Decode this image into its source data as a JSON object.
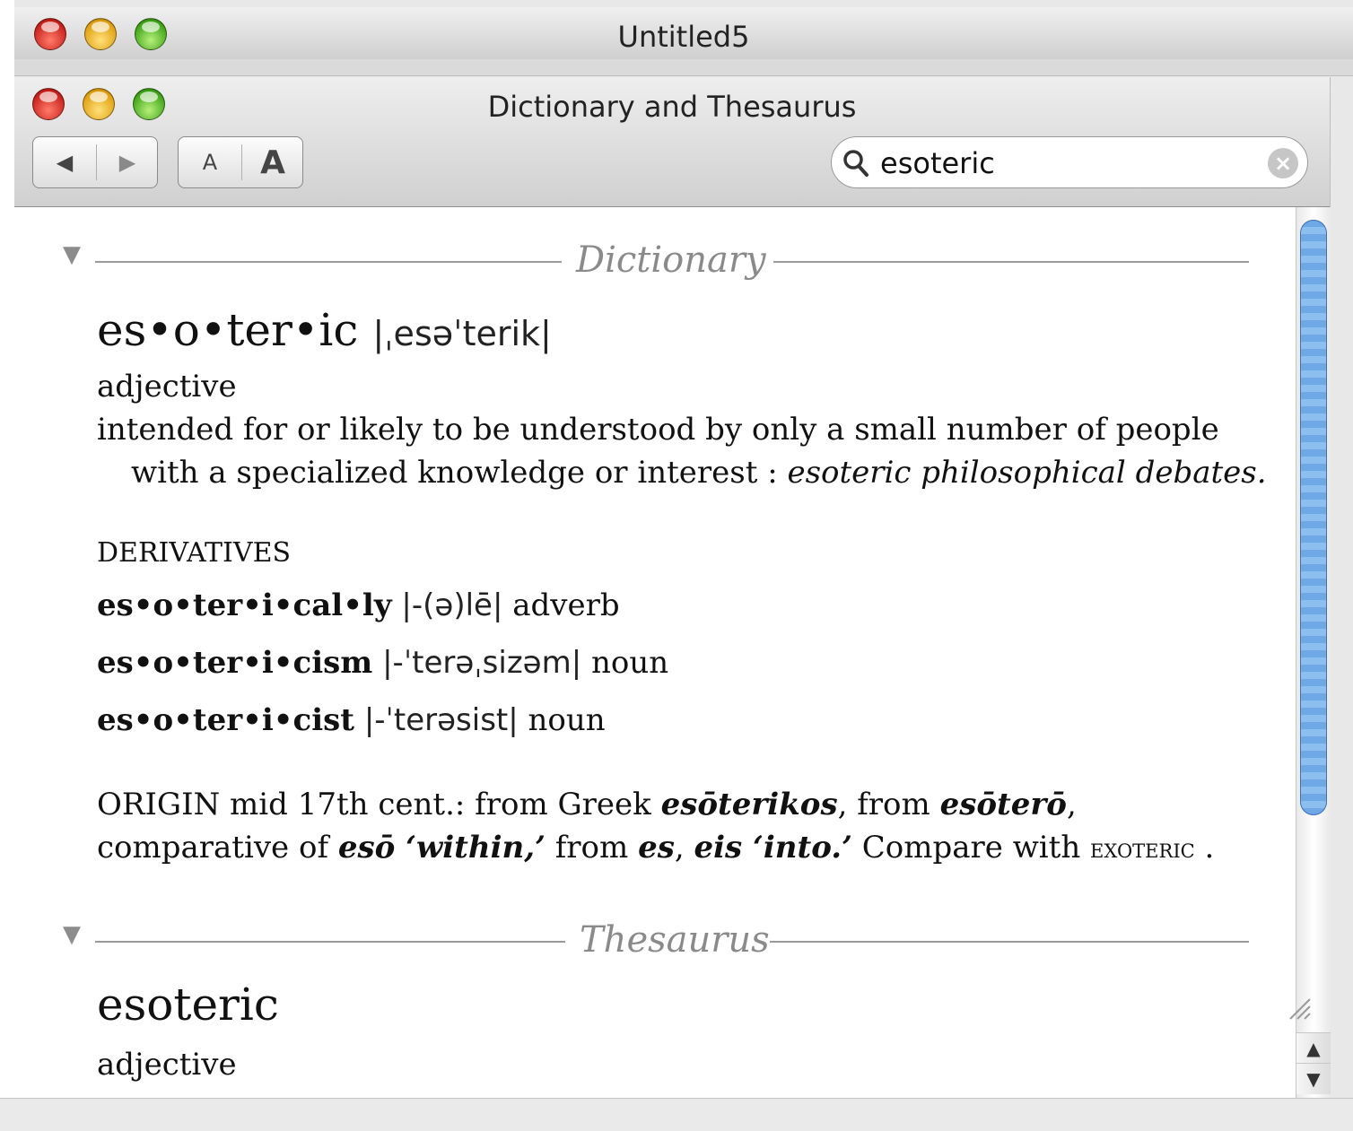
{
  "back_window": {
    "title": "Untitled5"
  },
  "front_window": {
    "title": "Dictionary and Thesaurus"
  },
  "toolbar": {
    "back_label": "◀",
    "forward_label": "▶",
    "font_smaller_label": "A",
    "font_larger_label": "A"
  },
  "search": {
    "value": "esoteric",
    "placeholder": ""
  },
  "dictionary": {
    "section_label": "Dictionary",
    "headword": "es•o•ter•ic",
    "pronunciation": "|ˌesəˈterik|",
    "pos": "adjective",
    "definition_line1": "intended for or likely to be understood by only a small number of people",
    "definition_line2": "with a specialized knowledge or interest : ",
    "example": "esoteric philosophical debates.",
    "derivatives_label": "DERIVATIVES",
    "derivatives": [
      {
        "word": "es•o•ter•i•cal•ly",
        "pron": "|-(ə)lē|",
        "pos": "adverb"
      },
      {
        "word": "es•o•ter•i•cism",
        "pron": "|-ˈterəˌsizəm|",
        "pos": "noun"
      },
      {
        "word": "es•o•ter•i•cist",
        "pron": "|-ˈterəsist|",
        "pos": "noun"
      }
    ],
    "origin": {
      "a": "ORIGIN mid 17th cent.: from Greek ",
      "b": "esōterikos",
      "c": ", from ",
      "d": "esōterō",
      "e": ",",
      "f": "comparative of ",
      "g": "esō ‘within,’",
      "h": " from ",
      "i": "es",
      "j": ", ",
      "k": "eis ‘into.’",
      "l": " Compare with ",
      "m": "exoteric",
      "n": " ."
    }
  },
  "thesaurus": {
    "section_label": "Thesaurus",
    "headword": "esoteric",
    "pos": "adjective"
  },
  "scrollbar": {
    "up_label": "▲",
    "down_label": "▼"
  }
}
